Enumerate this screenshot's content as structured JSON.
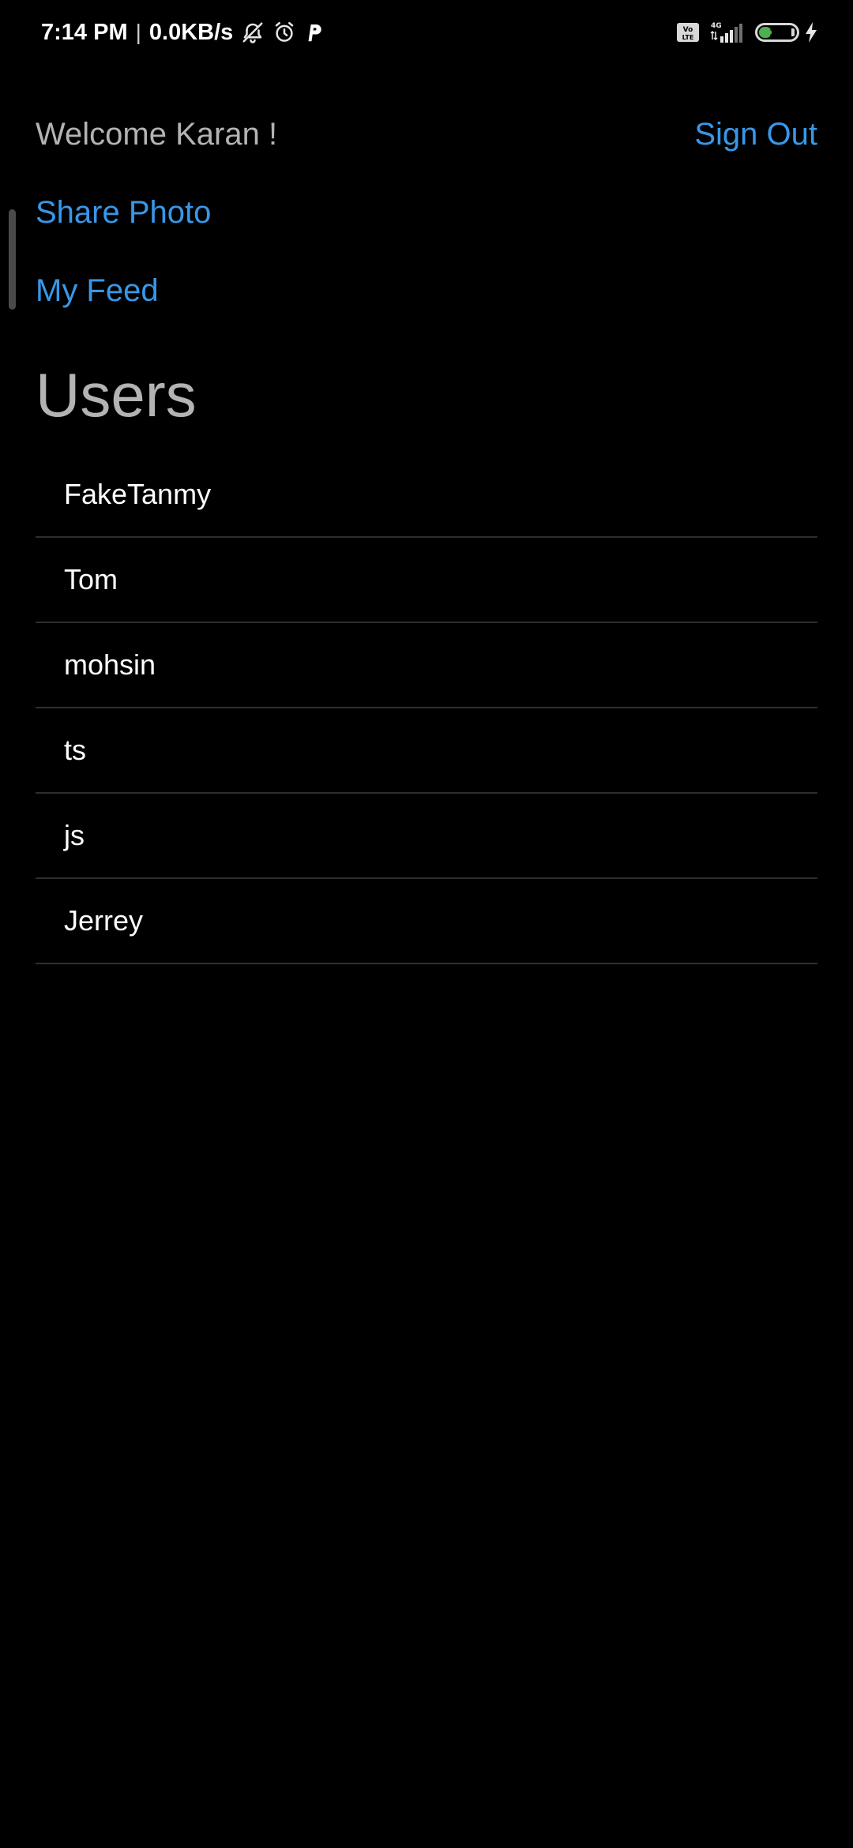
{
  "status_bar": {
    "time": "7:14 PM",
    "separator": "|",
    "network_speed": "0.0KB/s",
    "icons_left": [
      "bell-off-icon",
      "alarm-clock-icon",
      "parking-app-icon"
    ],
    "icons_right": [
      "volte-icon",
      "4g-signal-icon",
      "battery-icon",
      "charging-bolt-icon"
    ],
    "battery_percent": "39",
    "battery_level": 0.39,
    "network_type": "4G"
  },
  "header": {
    "welcome": "Welcome Karan !",
    "sign_out": "Sign Out"
  },
  "nav": {
    "share_photo": "Share Photo",
    "my_feed": "My Feed"
  },
  "users": {
    "heading": "Users",
    "items": [
      "FakeTanmy",
      "Tom",
      "mohsin",
      "ts",
      "js",
      "Jerrey"
    ]
  },
  "colors": {
    "background": "#000000",
    "link": "#3897e8",
    "muted_text": "#b3b3b3",
    "divider": "#2e2e2e",
    "battery_fill": "#4caf50"
  }
}
